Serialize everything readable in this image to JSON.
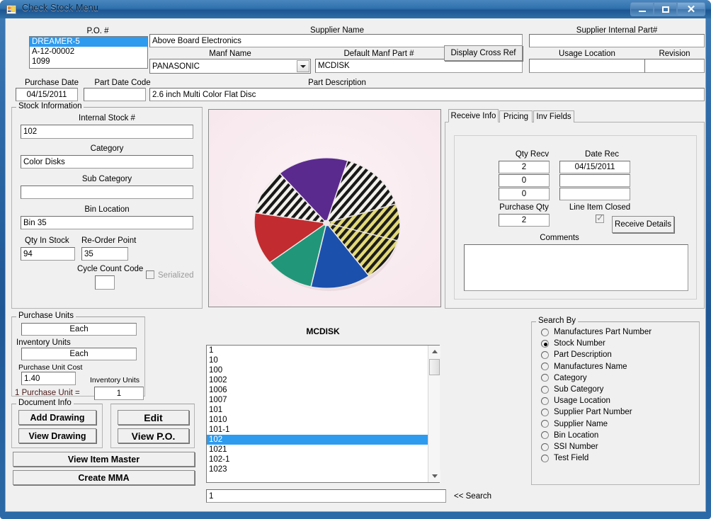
{
  "window": {
    "title": "Check Stock Menu",
    "icon": "form-icon",
    "minimize": "minimize-icon",
    "maximize": "maximize-icon",
    "close": "close-icon"
  },
  "header": {
    "po_label": "P.O. #",
    "po_items": [
      "DREAMER-5",
      "A-12-00002",
      "1099"
    ],
    "po_selected_index": 0,
    "supplier_name_label": "Supplier Name",
    "supplier_name_value": "Above Board Electronics",
    "supplier_internal_part_label": "Supplier Internal Part#",
    "supplier_internal_part_value": "",
    "manf_name_label": "Manf Name",
    "manf_name_value": "PANASONIC",
    "default_manf_part_label": "Default Manf Part #",
    "default_manf_part_value": "MCDISK",
    "display_cross_ref_label": "Display Cross Ref",
    "usage_location_label": "Usage Location",
    "usage_location_value": "",
    "revision_label": "Revision",
    "revision_value": "",
    "purchase_date_label": "Purchase Date",
    "purchase_date_value": "04/15/2011",
    "part_date_code_label": "Part Date Code",
    "part_date_code_value": "",
    "part_description_label": "Part Description",
    "part_description_value": "2.6 inch Multi Color Flat Disc"
  },
  "stock_information": {
    "title": "Stock Information",
    "internal_stock_label": "Internal Stock #",
    "internal_stock_value": "102",
    "category_label": "Category",
    "category_value": "Color Disks",
    "sub_category_label": "Sub Category",
    "sub_category_value": "",
    "bin_location_label": "Bin Location",
    "bin_location_value": "Bin 35",
    "qty_in_stock_label": "Qty In Stock",
    "qty_in_stock_value": "94",
    "reorder_point_label": "Re-Order Point",
    "reorder_point_value": "35",
    "cycle_count_code_label": "Cycle Count Code",
    "cycle_count_code_value": "",
    "serialized_label": "Serialized",
    "serialized_checked": false
  },
  "picture": {
    "alt": "Photograph of a 2.6 inch multi color flat disc divided into colored and striped wedges",
    "background": "#fdf2f5"
  },
  "tabs": {
    "items": [
      {
        "label": "Receive Info",
        "active": true
      },
      {
        "label": "Pricing",
        "active": false
      },
      {
        "label": "Inv Fields",
        "active": false
      }
    ]
  },
  "receive_info": {
    "qty_recv_label": "Qty Recv",
    "date_rec_label": "Date Rec",
    "qty_recv_values": [
      "2",
      "0",
      "0"
    ],
    "date_rec_values": [
      "04/15/2011",
      "",
      ""
    ],
    "purchase_qty_label": "Purchase Qty",
    "purchase_qty_value": "2",
    "line_item_closed_label": "Line Item Closed",
    "line_item_closed_checked": true,
    "receive_details_label": "Receive Details",
    "comments_label": "Comments",
    "comments_value": ""
  },
  "purchase_units": {
    "title": "Purchase Units",
    "purchase_units_value": "Each",
    "inventory_units_label": "Inventory Units",
    "inventory_units_value": "Each",
    "purchase_unit_cost_label": "Purchase Unit Cost",
    "purchase_unit_cost_value": "1.40",
    "inventory_units_small_label": "Inventory Units",
    "conversion_label": "1 Purchase Unit =",
    "conversion_value": "1"
  },
  "document_info": {
    "title": "Document Info",
    "add_drawing_label": "Add Drawing",
    "view_drawing_label": "View Drawing",
    "edit_label": "Edit",
    "view_po_label": "View P.O.",
    "view_item_master_label": "View Item Master",
    "create_mma_label": "Create MMA"
  },
  "results": {
    "header": "MCDISK",
    "items": [
      "1",
      "10",
      "100",
      "1002",
      "1006",
      "1007",
      "101",
      "1010",
      "101-1",
      "102",
      "1021",
      "102-1",
      "1023"
    ],
    "selected": "102"
  },
  "search": {
    "group_title": "Search By",
    "options": [
      {
        "label": "Manufactures Part Number",
        "selected": false
      },
      {
        "label": "Stock Number",
        "selected": true
      },
      {
        "label": "Part Description",
        "selected": false
      },
      {
        "label": "Manufactures Name",
        "selected": false
      },
      {
        "label": "Category",
        "selected": false
      },
      {
        "label": "Sub Category",
        "selected": false
      },
      {
        "label": "Usage Location",
        "selected": false
      },
      {
        "label": "Supplier Part Number",
        "selected": false
      },
      {
        "label": "Supplier Name",
        "selected": false
      },
      {
        "label": "Bin Location",
        "selected": false
      },
      {
        "label": "SSI Number",
        "selected": false
      },
      {
        "label": "Test Field",
        "selected": false
      }
    ],
    "input_value": "1",
    "button_label": "<< Search"
  },
  "colors": {
    "titlebar": "#2e6ba8",
    "selection": "#2e9bef",
    "face": "#f0f0f0"
  }
}
